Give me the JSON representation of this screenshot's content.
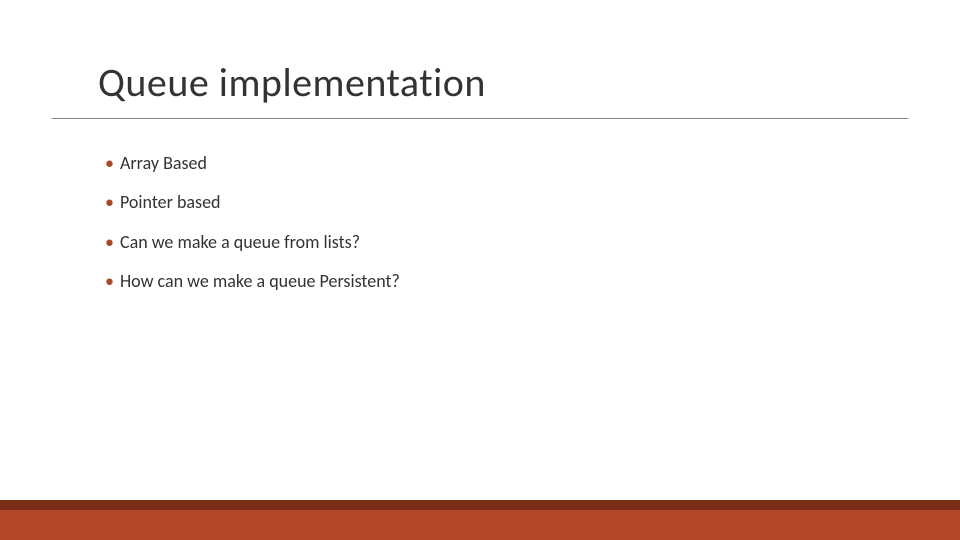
{
  "slide": {
    "title": "Queue implementation",
    "bullets": [
      "Array Based",
      "Pointer based",
      "Can we make a queue from lists?",
      "How can we make a queue Persistent?"
    ]
  },
  "theme": {
    "accent": "#b5472a",
    "accent_dark": "#7a2e18",
    "text": "#333333"
  }
}
